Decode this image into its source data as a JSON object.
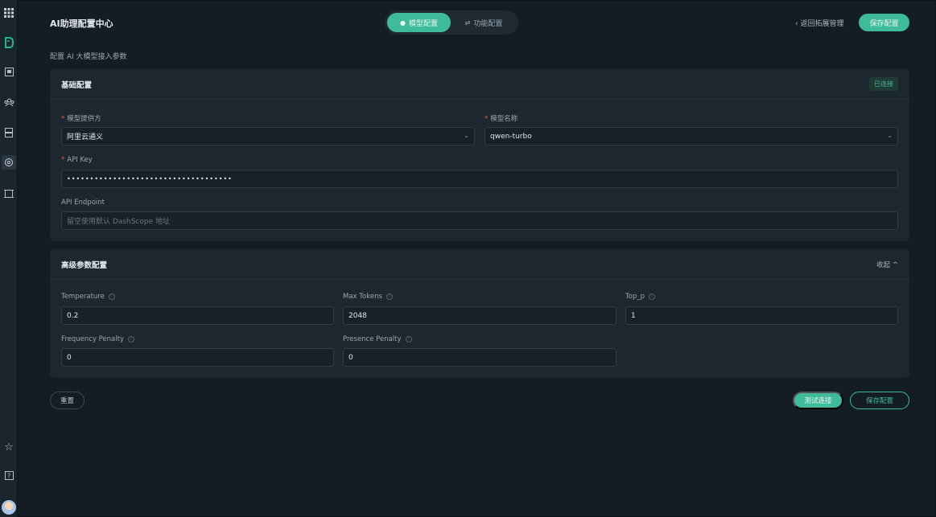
{
  "header": {
    "title": "AI助理配置中心",
    "tabs": [
      {
        "label": "模型配置",
        "active": true
      },
      {
        "label": "功能配置",
        "active": false
      }
    ],
    "back_label": "返回拓展管理",
    "save_label": "保存配置"
  },
  "subtitle": "配置 AI 大模型接入参数",
  "basic": {
    "title": "基础配置",
    "status": "已连接",
    "provider_label": "模型提供方",
    "provider_value": "阿里云通义",
    "model_label": "模型名称",
    "model_value": "qwen-turbo",
    "apikey_label": "API Key",
    "apikey_value": "••••••••••••••••••••••••••••••••••••",
    "endpoint_label": "API Endpoint",
    "endpoint_placeholder": "留空使用默认 DashScope 地址"
  },
  "advanced": {
    "title": "高级参数配置",
    "collapse_label": "收起 ^",
    "temperature_label": "Temperature",
    "temperature_value": "0.2",
    "max_tokens_label": "Max Tokens",
    "max_tokens_value": "2048",
    "top_p_label": "Top_p",
    "top_p_value": "1",
    "freq_label": "Frequency Penalty",
    "freq_value": "0",
    "pres_label": "Presence Penalty",
    "pres_value": "0"
  },
  "footer": {
    "reset_label": "重置",
    "test_label": "测试连接",
    "save_label": "保存配置"
  },
  "rail_icons": [
    "apps-grid-icon",
    "brand-logo-icon",
    "dashboard-icon",
    "team-icon",
    "server-icon",
    "settings-icon",
    "extension-icon",
    "star-icon",
    "help-icon"
  ],
  "colors": {
    "accent": "#3dbb9a",
    "background": "#151d24",
    "card": "#1d272f",
    "required": "#e0584c"
  }
}
